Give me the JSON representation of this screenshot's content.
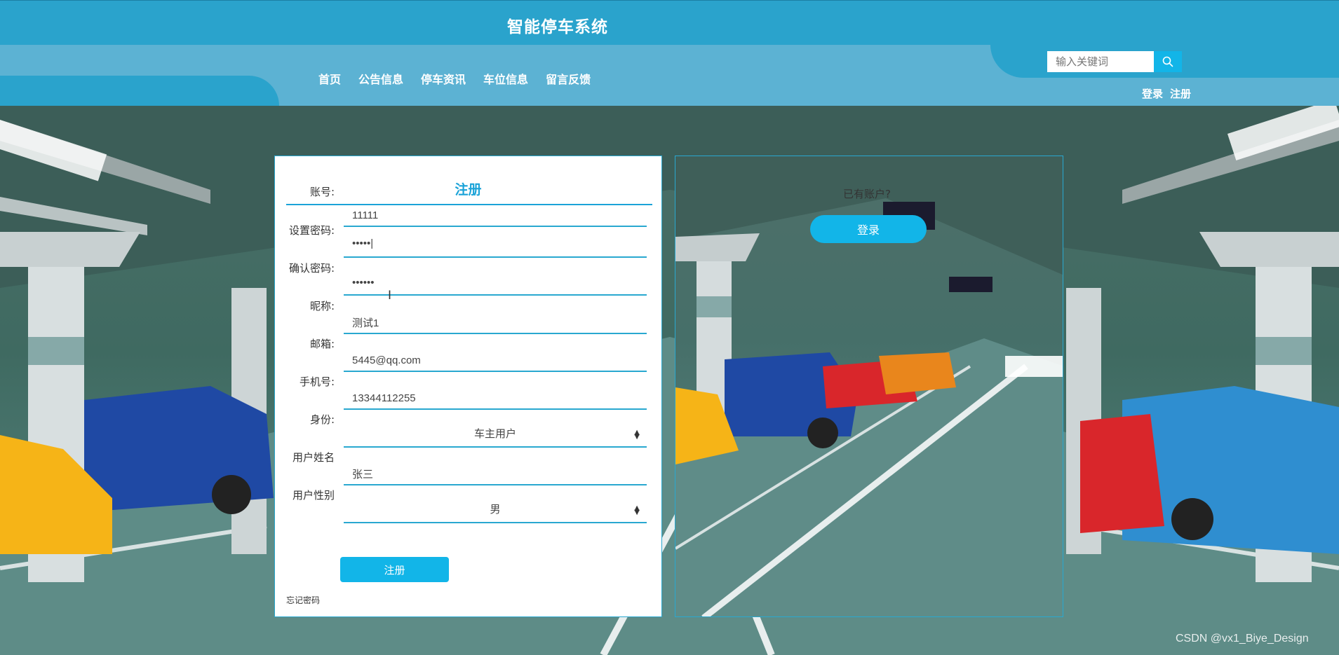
{
  "header": {
    "site_title": "智能停车系统",
    "nav": [
      "首页",
      "公告信息",
      "停车资讯",
      "车位信息",
      "留言反馈"
    ],
    "search_placeholder": "输入关键词",
    "login_link": "登录",
    "register_link": "注册"
  },
  "register": {
    "title": "注册",
    "fields": [
      {
        "label": "账号:",
        "value": "11111",
        "type": "text"
      },
      {
        "label": "设置密码:",
        "value": "•••••|",
        "type": "password"
      },
      {
        "label": "确认密码:",
        "value": "••••••",
        "type": "password"
      },
      {
        "label": "昵称:",
        "value": "测试1",
        "type": "text"
      },
      {
        "label": "邮箱:",
        "value": "5445@qq.com",
        "type": "text"
      },
      {
        "label": "手机号:",
        "value": "13344112255",
        "type": "text"
      },
      {
        "label": "身份:",
        "value": "车主用户",
        "type": "select"
      },
      {
        "label": "用户姓名",
        "value": "张三",
        "type": "text"
      },
      {
        "label": "用户性别",
        "value": "男",
        "type": "select"
      }
    ],
    "submit_label": "注册",
    "forgot_label": "忘记密码"
  },
  "login_panel": {
    "prompt": "已有账户?",
    "button_label": "登录"
  },
  "watermark": "CSDN @vx1_Biye_Design",
  "colors": {
    "primary": "#2aa3cc",
    "accent": "#12b5e8",
    "nav_bg": "#5cb2d3"
  }
}
